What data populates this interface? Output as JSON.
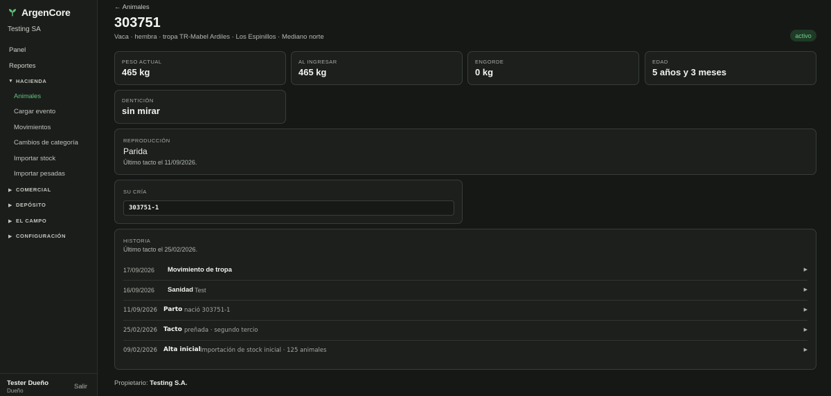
{
  "sidebar": {
    "brand": "ArgenCore",
    "org": "Testing SA",
    "items": [
      {
        "label": "Panel"
      },
      {
        "label": "Reportes"
      }
    ],
    "hacienda": {
      "label": "HACIENDA",
      "items": [
        "Animales",
        "Cargar evento",
        "Movimientos",
        "Cambios de categoría",
        "Importar stock",
        "Importar pesadas"
      ]
    },
    "sections": [
      "COMERCIAL",
      "DEPÓSITO",
      "EL CAMPO",
      "CONFIGURACIÓN"
    ],
    "user": {
      "name": "Tester Dueño",
      "role": "Dueño",
      "logout": "Salir"
    }
  },
  "header": {
    "back": "← Animales",
    "title": "303751",
    "subtitle": "Vaca · hembra · tropa TR-Mabel Ardiles · Los Espinillos · Mediano norte",
    "status": "activo"
  },
  "stats": [
    {
      "label": "PESO ACTUAL",
      "value": "465 kg"
    },
    {
      "label": "AL INGRESAR",
      "value": "465 kg"
    },
    {
      "label": "ENGORDE",
      "value": "0 kg"
    },
    {
      "label": "EDAD",
      "value": "5 años y 3 meses"
    },
    {
      "label": "DENTICIÓN",
      "value": "sin mirar"
    }
  ],
  "reproduccion": {
    "label": "REPRODUCCIÓN",
    "value": "Parida",
    "note": "Último tacto el 11/09/2026."
  },
  "cria": {
    "label": "SU CRÍA",
    "id": "303751-1"
  },
  "historia": {
    "label": "HISTORIA",
    "note": "Último tacto el 25/02/2026.",
    "rows": [
      {
        "date": "17/09/2026",
        "type": "Movimiento de tropa",
        "detail": ""
      },
      {
        "date": "16/09/2026",
        "type": "Sanidad",
        "detail": "Test"
      },
      {
        "date": "11/09/2026",
        "type": "Parto",
        "detail": "nació 303751-1"
      },
      {
        "date": "25/02/2026",
        "type": "Tacto",
        "detail": "preñada · segundo tercio"
      },
      {
        "date": "09/02/2026",
        "type": "Alta inicial",
        "detail": "Importación de stock inicial · 125 animales"
      }
    ]
  },
  "footer": {
    "owner_label": "Propietario:",
    "owner": "Testing S.A."
  },
  "colors": {
    "accent": "#5fc479",
    "background": "#161816",
    "card": "#1c1f1c",
    "badge_bg": "#1f3a26"
  },
  "icons": {
    "brand": "leaf-logo-icon",
    "expanded": "caret-down-icon",
    "collapsed": "caret-right-icon",
    "row": "chevron-right-icon"
  }
}
